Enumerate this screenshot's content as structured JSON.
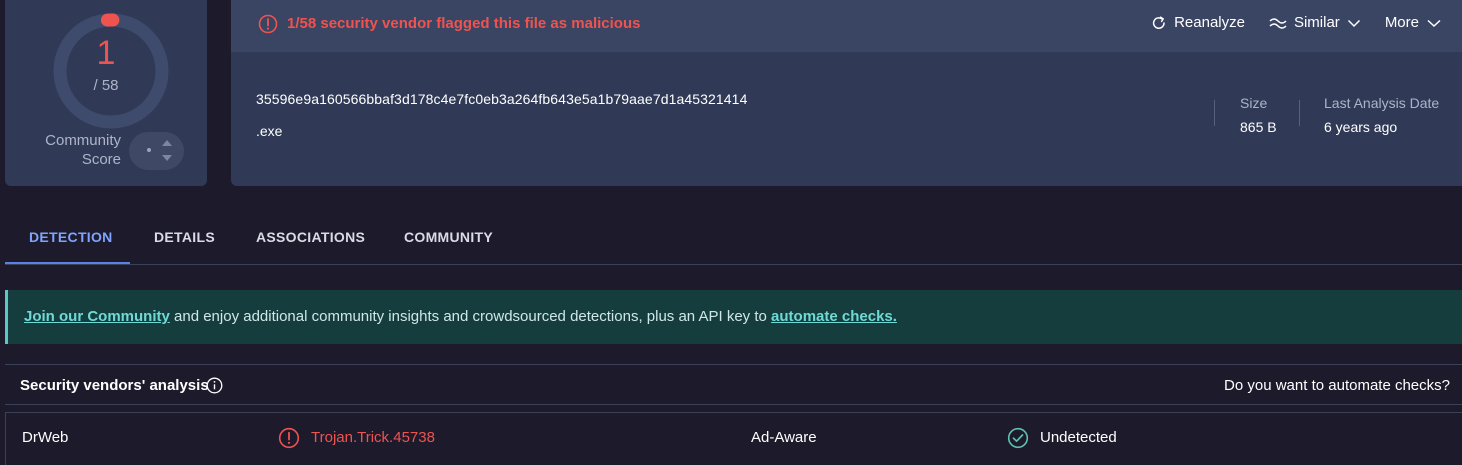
{
  "score": {
    "detections": "1",
    "total": "/ 58",
    "community_label_line1": "Community",
    "community_label_line2": "Score",
    "ratio": 0.0172,
    "accent_color": "#ef5350"
  },
  "file": {
    "alert_text": "1/58 security vendor flagged this file as malicious",
    "hash": "35596e9a160566bbaf3d178c4e7fc0eb3a264fb643e5a1b79aae7d1a45321414",
    "extension": ".exe",
    "size_label": "Size",
    "size_value": "865 B",
    "date_label": "Last Analysis Date",
    "date_value": "6 years ago"
  },
  "actions": [
    {
      "label": "Reanalyze",
      "icon": "refresh-icon"
    },
    {
      "label": "Similar",
      "icon": "similar-icon"
    },
    {
      "label": "More",
      "icon": "chevron-down-icon"
    }
  ],
  "tabs": [
    {
      "label": "DETECTION",
      "active": true
    },
    {
      "label": "DETAILS",
      "active": false
    },
    {
      "label": "ASSOCIATIONS",
      "active": false
    },
    {
      "label": "COMMUNITY",
      "active": false
    }
  ],
  "banner": {
    "link1": "Join our Community",
    "middle": " and enjoy additional community insights and crowdsourced detections, plus an API key to ",
    "link2": "automate checks."
  },
  "analysis": {
    "title": "Security vendors' analysis",
    "automate_question": "Do you want to automate checks?",
    "rows": [
      {
        "vendor1": "DrWeb",
        "result1": "Trojan.Trick.45738",
        "vendor2": "Ad-Aware",
        "result2": "Undetected"
      }
    ]
  }
}
